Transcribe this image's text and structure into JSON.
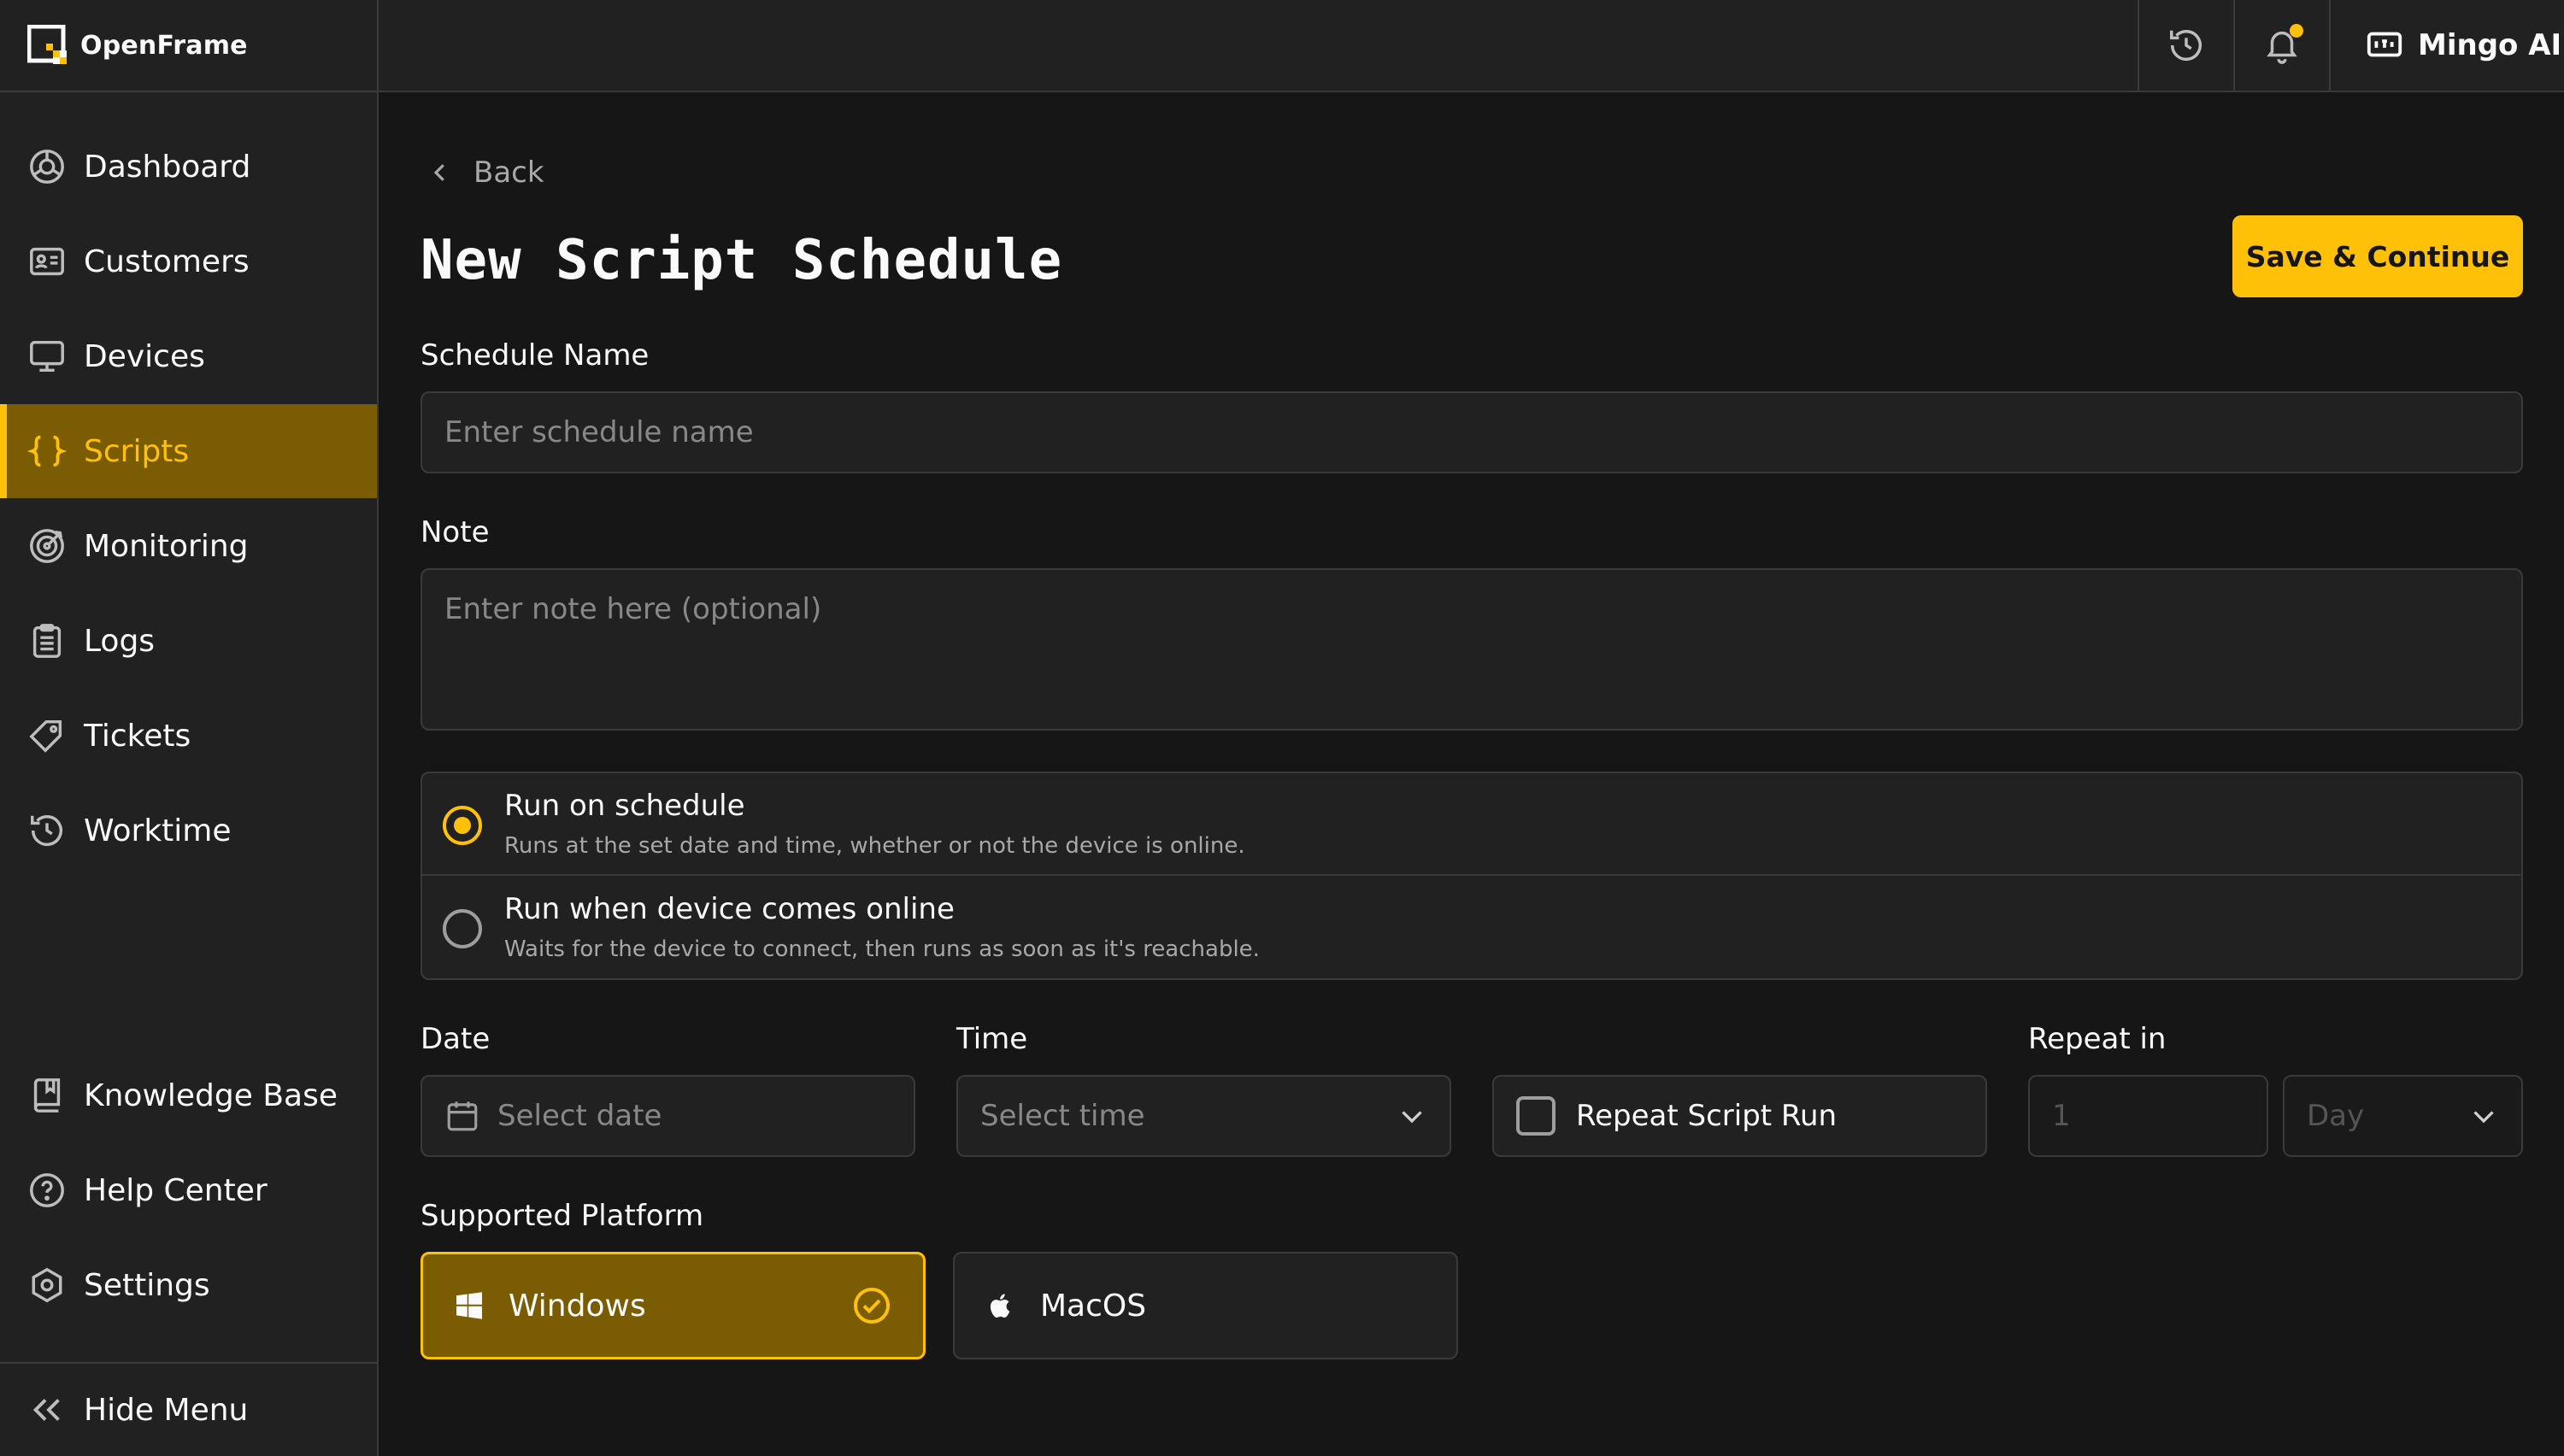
{
  "app": {
    "name": "OpenFrame",
    "user": "Mingo AI"
  },
  "sidebar": {
    "items": [
      {
        "label": "Dashboard",
        "icon": "dashboard-icon"
      },
      {
        "label": "Customers",
        "icon": "id-card-icon"
      },
      {
        "label": "Devices",
        "icon": "monitor-icon"
      },
      {
        "label": "Scripts",
        "icon": "braces-icon",
        "active": true
      },
      {
        "label": "Monitoring",
        "icon": "target-icon"
      },
      {
        "label": "Logs",
        "icon": "clipboard-icon"
      },
      {
        "label": "Tickets",
        "icon": "tag-icon"
      },
      {
        "label": "Worktime",
        "icon": "history-icon"
      }
    ],
    "bottom_items": [
      {
        "label": "Knowledge Base",
        "icon": "book-icon"
      },
      {
        "label": "Help Center",
        "icon": "help-icon"
      },
      {
        "label": "Settings",
        "icon": "settings-icon"
      }
    ],
    "hide_menu": "Hide Menu"
  },
  "page": {
    "back": "Back",
    "title": "New Script Schedule",
    "save_button": "Save & Continue"
  },
  "form": {
    "schedule_name": {
      "label": "Schedule Name",
      "placeholder": "Enter schedule name",
      "value": ""
    },
    "note": {
      "label": "Note",
      "placeholder": "Enter note here (optional)",
      "value": ""
    },
    "run_mode": {
      "selected": "on_schedule",
      "options": [
        {
          "title": "Run on schedule",
          "description": "Runs at the set date and time, whether or not the device is online."
        },
        {
          "title": "Run when device comes online",
          "description": "Waits for the device to connect, then runs as soon as it's reachable."
        }
      ]
    },
    "date": {
      "label": "Date",
      "placeholder": "Select date"
    },
    "time": {
      "label": "Time",
      "placeholder": "Select time"
    },
    "repeat": {
      "checkbox_label": "Repeat Script Run",
      "checked": false
    },
    "repeat_in": {
      "label": "Repeat in",
      "count_placeholder": "1",
      "unit_placeholder": "Day"
    },
    "platform": {
      "label": "Supported Platform",
      "options": [
        {
          "name": "Windows",
          "selected": true
        },
        {
          "name": "MacOS",
          "selected": false
        }
      ]
    }
  },
  "colors": {
    "accent": "#ffc008",
    "active_bg": "#7a5c03",
    "surface": "#212121",
    "background": "#161616",
    "border": "#3a3a3a"
  }
}
